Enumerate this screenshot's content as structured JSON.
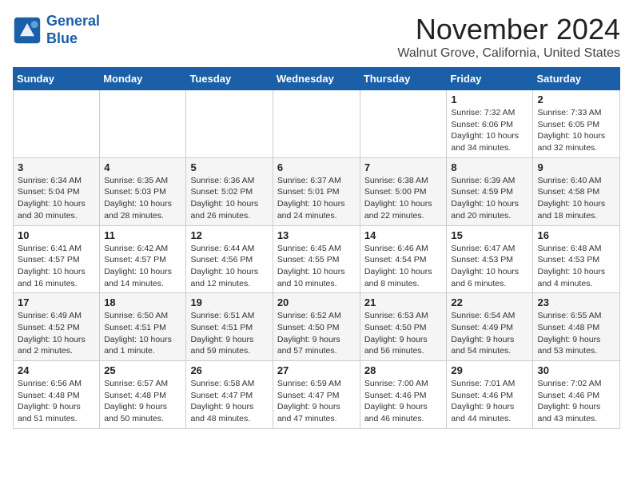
{
  "header": {
    "logo_line1": "General",
    "logo_line2": "Blue",
    "month": "November 2024",
    "location": "Walnut Grove, California, United States"
  },
  "weekdays": [
    "Sunday",
    "Monday",
    "Tuesday",
    "Wednesday",
    "Thursday",
    "Friday",
    "Saturday"
  ],
  "weeks": [
    [
      {
        "day": "",
        "info": ""
      },
      {
        "day": "",
        "info": ""
      },
      {
        "day": "",
        "info": ""
      },
      {
        "day": "",
        "info": ""
      },
      {
        "day": "",
        "info": ""
      },
      {
        "day": "1",
        "info": "Sunrise: 7:32 AM\nSunset: 6:06 PM\nDaylight: 10 hours\nand 34 minutes."
      },
      {
        "day": "2",
        "info": "Sunrise: 7:33 AM\nSunset: 6:05 PM\nDaylight: 10 hours\nand 32 minutes."
      }
    ],
    [
      {
        "day": "3",
        "info": "Sunrise: 6:34 AM\nSunset: 5:04 PM\nDaylight: 10 hours\nand 30 minutes."
      },
      {
        "day": "4",
        "info": "Sunrise: 6:35 AM\nSunset: 5:03 PM\nDaylight: 10 hours\nand 28 minutes."
      },
      {
        "day": "5",
        "info": "Sunrise: 6:36 AM\nSunset: 5:02 PM\nDaylight: 10 hours\nand 26 minutes."
      },
      {
        "day": "6",
        "info": "Sunrise: 6:37 AM\nSunset: 5:01 PM\nDaylight: 10 hours\nand 24 minutes."
      },
      {
        "day": "7",
        "info": "Sunrise: 6:38 AM\nSunset: 5:00 PM\nDaylight: 10 hours\nand 22 minutes."
      },
      {
        "day": "8",
        "info": "Sunrise: 6:39 AM\nSunset: 4:59 PM\nDaylight: 10 hours\nand 20 minutes."
      },
      {
        "day": "9",
        "info": "Sunrise: 6:40 AM\nSunset: 4:58 PM\nDaylight: 10 hours\nand 18 minutes."
      }
    ],
    [
      {
        "day": "10",
        "info": "Sunrise: 6:41 AM\nSunset: 4:57 PM\nDaylight: 10 hours\nand 16 minutes."
      },
      {
        "day": "11",
        "info": "Sunrise: 6:42 AM\nSunset: 4:57 PM\nDaylight: 10 hours\nand 14 minutes."
      },
      {
        "day": "12",
        "info": "Sunrise: 6:44 AM\nSunset: 4:56 PM\nDaylight: 10 hours\nand 12 minutes."
      },
      {
        "day": "13",
        "info": "Sunrise: 6:45 AM\nSunset: 4:55 PM\nDaylight: 10 hours\nand 10 minutes."
      },
      {
        "day": "14",
        "info": "Sunrise: 6:46 AM\nSunset: 4:54 PM\nDaylight: 10 hours\nand 8 minutes."
      },
      {
        "day": "15",
        "info": "Sunrise: 6:47 AM\nSunset: 4:53 PM\nDaylight: 10 hours\nand 6 minutes."
      },
      {
        "day": "16",
        "info": "Sunrise: 6:48 AM\nSunset: 4:53 PM\nDaylight: 10 hours\nand 4 minutes."
      }
    ],
    [
      {
        "day": "17",
        "info": "Sunrise: 6:49 AM\nSunset: 4:52 PM\nDaylight: 10 hours\nand 2 minutes."
      },
      {
        "day": "18",
        "info": "Sunrise: 6:50 AM\nSunset: 4:51 PM\nDaylight: 10 hours\nand 1 minute."
      },
      {
        "day": "19",
        "info": "Sunrise: 6:51 AM\nSunset: 4:51 PM\nDaylight: 9 hours\nand 59 minutes."
      },
      {
        "day": "20",
        "info": "Sunrise: 6:52 AM\nSunset: 4:50 PM\nDaylight: 9 hours\nand 57 minutes."
      },
      {
        "day": "21",
        "info": "Sunrise: 6:53 AM\nSunset: 4:50 PM\nDaylight: 9 hours\nand 56 minutes."
      },
      {
        "day": "22",
        "info": "Sunrise: 6:54 AM\nSunset: 4:49 PM\nDaylight: 9 hours\nand 54 minutes."
      },
      {
        "day": "23",
        "info": "Sunrise: 6:55 AM\nSunset: 4:48 PM\nDaylight: 9 hours\nand 53 minutes."
      }
    ],
    [
      {
        "day": "24",
        "info": "Sunrise: 6:56 AM\nSunset: 4:48 PM\nDaylight: 9 hours\nand 51 minutes."
      },
      {
        "day": "25",
        "info": "Sunrise: 6:57 AM\nSunset: 4:48 PM\nDaylight: 9 hours\nand 50 minutes."
      },
      {
        "day": "26",
        "info": "Sunrise: 6:58 AM\nSunset: 4:47 PM\nDaylight: 9 hours\nand 48 minutes."
      },
      {
        "day": "27",
        "info": "Sunrise: 6:59 AM\nSunset: 4:47 PM\nDaylight: 9 hours\nand 47 minutes."
      },
      {
        "day": "28",
        "info": "Sunrise: 7:00 AM\nSunset: 4:46 PM\nDaylight: 9 hours\nand 46 minutes."
      },
      {
        "day": "29",
        "info": "Sunrise: 7:01 AM\nSunset: 4:46 PM\nDaylight: 9 hours\nand 44 minutes."
      },
      {
        "day": "30",
        "info": "Sunrise: 7:02 AM\nSunset: 4:46 PM\nDaylight: 9 hours\nand 43 minutes."
      }
    ]
  ]
}
